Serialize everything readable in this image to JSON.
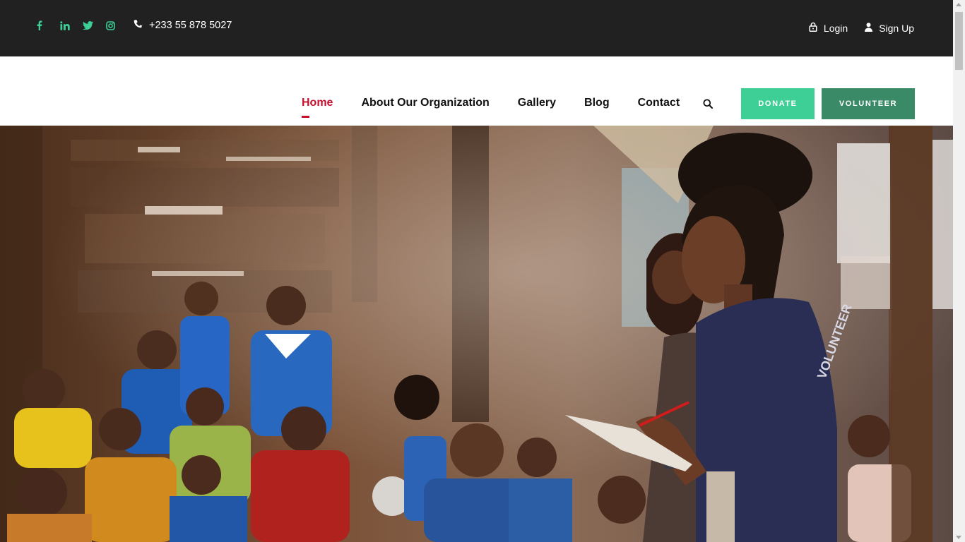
{
  "topbar": {
    "social": [
      {
        "icon": "facebook-icon"
      },
      {
        "icon": "linkedin-icon"
      },
      {
        "icon": "twitter-icon"
      },
      {
        "icon": "instagram-icon"
      }
    ],
    "phone": "+233 55 878 5027",
    "login_label": "Login",
    "signup_label": "Sign Up"
  },
  "nav": {
    "items": [
      {
        "label": "Home",
        "active": true
      },
      {
        "label": "About Our Organization"
      },
      {
        "label": "Gallery"
      },
      {
        "label": "Blog"
      },
      {
        "label": "Contact"
      }
    ],
    "donate_label": "DONATE",
    "volunteer_label": "VOLUNTEER"
  },
  "hero": {
    "shirt_text": "VOLUNTEER"
  },
  "colors": {
    "topbar_bg": "#212121",
    "accent_green": "#3ecf96",
    "volunteer_green": "#3a8a68",
    "active_red": "#c8102e"
  }
}
